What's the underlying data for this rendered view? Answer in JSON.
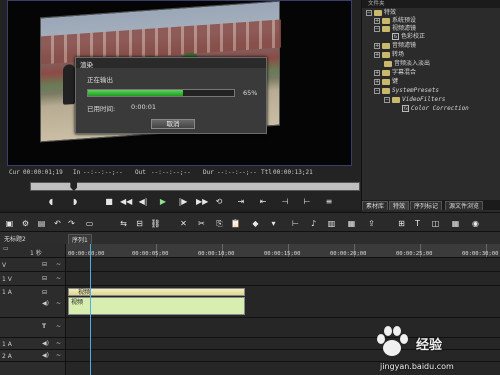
{
  "render_dialog": {
    "title": "渲染",
    "status": "正在输出",
    "progress_percent": 65,
    "progress_label": "65%",
    "elapsed_label": "已用时间:",
    "elapsed_value": "0:00:01",
    "cancel_label": "取消"
  },
  "player": {
    "cur_label": "Cur",
    "cur_value": "00:00:01;19",
    "in_label": "In",
    "in_value": "--:--:--;--",
    "out_label": "Out",
    "out_value": "--:--:--;--",
    "dur_label": "Dur",
    "dur_value": "--:--:--;--",
    "ttl_label": "Ttl",
    "ttl_value": "00:00:13;21",
    "scrub_position": 0.12
  },
  "effects_panel": {
    "header": "文件夹",
    "tree": [
      {
        "label": "特效",
        "kind": "folder"
      },
      {
        "label": "系统预设",
        "kind": "folder"
      },
      {
        "label": "视频滤镜",
        "kind": "folder"
      },
      {
        "label": "色彩校正",
        "kind": "fx"
      },
      {
        "label": "音频滤镜",
        "kind": "folder"
      },
      {
        "label": "转场",
        "kind": "folder"
      },
      {
        "label": "音频淡入淡出",
        "kind": "folder"
      },
      {
        "label": "字幕混合",
        "kind": "folder"
      },
      {
        "label": "键",
        "kind": "folder"
      },
      {
        "label": "SystemPresets",
        "kind": "folder"
      },
      {
        "label": "VideoFilters",
        "kind": "folder"
      },
      {
        "label": "Color Correction",
        "kind": "fx"
      }
    ],
    "tabs": [
      "素材库",
      "特效",
      "序列标记",
      "源文件浏览"
    ]
  },
  "timeline": {
    "sequence_title": "无标题2",
    "sequence_tab": "序列1",
    "scale_label": "1 秒",
    "ruler": [
      "00:00:00;00",
      "00:00:05;00",
      "00:00:10;00",
      "00:00:15;00",
      "00:00:20;00",
      "00:00:25;00",
      "00:00:30;00"
    ],
    "track_labels": [
      "V",
      "1 V",
      "1 A",
      "T",
      "1 A",
      "2 A"
    ],
    "video_clip_label": "视频",
    "audio_clip_label": "视频"
  },
  "watermark": {
    "text": "经验",
    "url": "jingyan.baidu.com"
  }
}
